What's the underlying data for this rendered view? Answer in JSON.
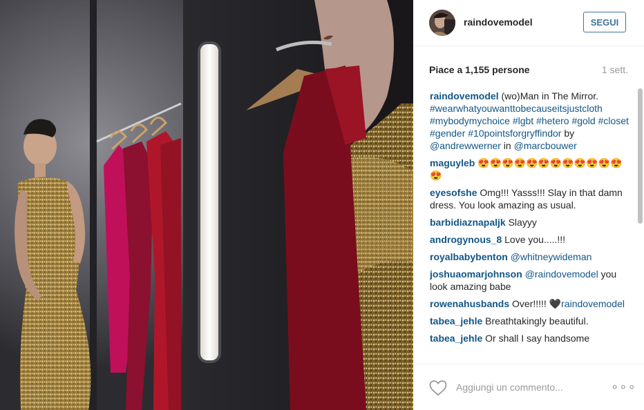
{
  "post": {
    "username": "raindovemodel",
    "follow_label": "SEGUI",
    "likes_text": "Piace a 1,155 persone",
    "time_text": "1 sett.",
    "comment_placeholder": "Aggiungi un commento...",
    "more_icon": "more-dots-icon",
    "like_icon": "heart-outline-icon"
  },
  "caption": {
    "user": "raindovemodel",
    "text": " (wo)Man in The Mirror. ",
    "tags": "#wearwhatyouwanttobecauseitsjustcloth #mybodymychoice #lgbt #hetero #gold #closet #gender #10pointsforgryffindor",
    "by": " by ",
    "mention1": "@andrewwerner",
    "in": " in ",
    "mention2": "@marcbouwer"
  },
  "comments": [
    {
      "user": "maguyleb",
      "text": " 😍😍😍😍😍😍😍😍😍😍😍😍😍"
    },
    {
      "user": "eyesofshe",
      "text": " Omg!!! Yasss!!! Slay in that damn dress. You look amazing as usual."
    },
    {
      "user": "barbidiaznapaljk",
      "text": " Slayyy"
    },
    {
      "user": "androgynous_8",
      "text": " Love you.....!!!"
    },
    {
      "user": "royalbabybenton",
      "mention": "@whitneywideman",
      "text": ""
    },
    {
      "user": "joshuaomarjohnson",
      "mention": "@raindovemodel",
      "text": " you look amazing babe"
    },
    {
      "user": "rowenahusbands",
      "text": " Over!!!!! ",
      "mention2": "🖤raindovemodel"
    },
    {
      "user": "tabea_jehle",
      "text": " Breathtakingly beautiful."
    },
    {
      "user": "tabea_jehle",
      "text": " Or shall I say handsome"
    }
  ],
  "colors": {
    "link": "#125688",
    "follow": "#3f729b",
    "muted": "#999999",
    "gold_dress": "#b8964a",
    "red_garment": "#b0162a",
    "magenta_garment": "#c0105a"
  }
}
